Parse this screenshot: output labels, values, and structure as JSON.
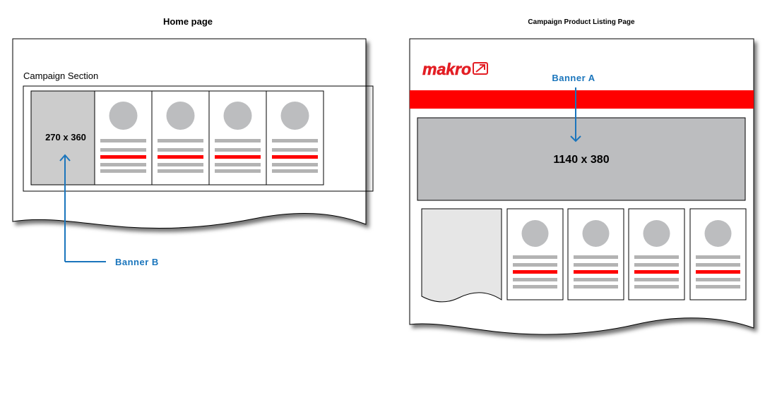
{
  "home": {
    "title": "Home page",
    "section_label": "Campaign Section",
    "banner_size": "270 x 360",
    "product_count": 4
  },
  "campaign": {
    "title": "Campaign Product Listing Page",
    "logo_text": "makro",
    "banner_size": "1140 x 380",
    "product_count": 4
  },
  "labels": {
    "banner_a": "Banner  A",
    "banner_b": "Banner  B"
  },
  "colors": {
    "accent_red": "#ff0000",
    "placeholder_gray": "#bcbdbf",
    "line_gray": "#b3b3b3",
    "annotation_blue": "#1a75bc",
    "banner_b_fill": "#cccccc",
    "side_panel_fill": "#e6e6e6"
  }
}
